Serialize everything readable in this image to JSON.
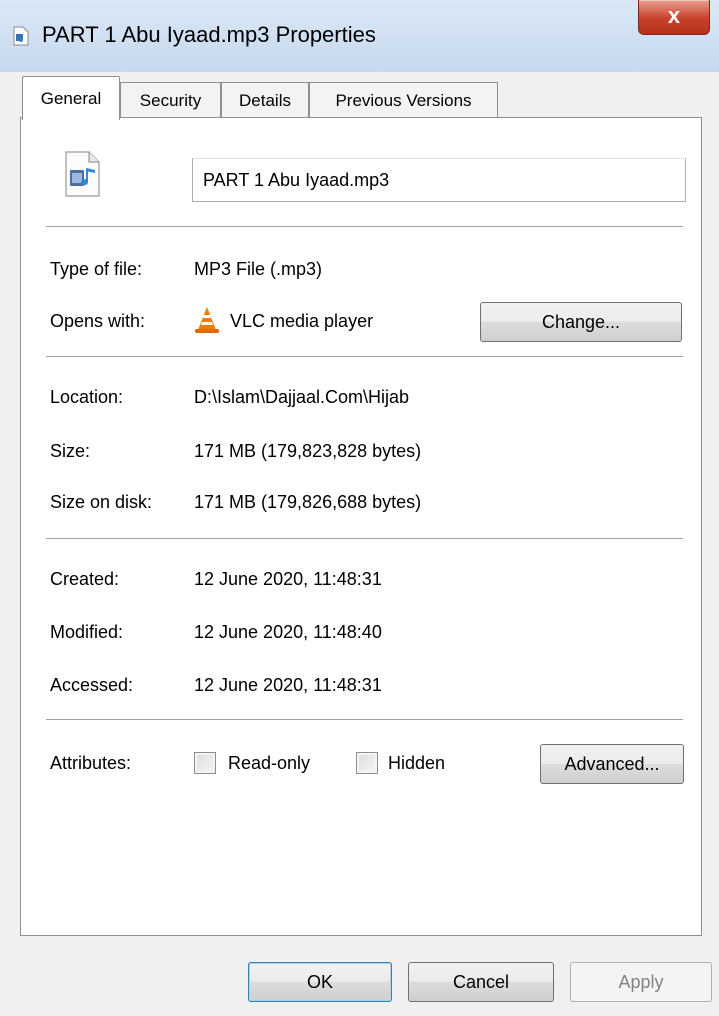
{
  "window": {
    "title": "PART 1 Abu Iyaad.mp3 Properties",
    "close_glyph": "x",
    "title_icon": "audio-file-icon",
    "close_icon": "close-icon"
  },
  "tabs": [
    {
      "label": "General",
      "active": true
    },
    {
      "label": "Security",
      "active": false
    },
    {
      "label": "Details",
      "active": false
    },
    {
      "label": "Previous Versions",
      "active": false
    }
  ],
  "general": {
    "file_icon": "mp3-file-icon",
    "file_name": "PART 1 Abu Iyaad.mp3",
    "type_label": "Type of file:",
    "type_value": "MP3 File (.mp3)",
    "opens_label": "Opens with:",
    "opens_icon": "vlc-icon",
    "opens_value": "VLC media player",
    "change_label": "Change...",
    "location_label": "Location:",
    "location_value": "D:\\Islam\\Dajjaal.Com\\Hijab",
    "size_label": "Size:",
    "size_value": "171 MB (179,823,828 bytes)",
    "size_disk_label": "Size on disk:",
    "size_disk_value": "171 MB (179,826,688 bytes)",
    "created_label": "Created:",
    "created_value": "12 June 2020, 11:48:31",
    "modified_label": "Modified:",
    "modified_value": "12 June 2020, 11:48:40",
    "accessed_label": "Accessed:",
    "accessed_value": "12 June 2020, 11:48:31",
    "attributes_label": "Attributes:",
    "readonly_label": "Read-only",
    "readonly_checked": false,
    "hidden_label": "Hidden",
    "hidden_checked": false,
    "advanced_label": "Advanced..."
  },
  "footer": {
    "ok_label": "OK",
    "cancel_label": "Cancel",
    "apply_label": "Apply",
    "apply_enabled": false
  },
  "colors": {
    "accent_focus": "#3c7fb1",
    "close_red": "#c7412d",
    "vlc_orange": "#f07d00"
  }
}
